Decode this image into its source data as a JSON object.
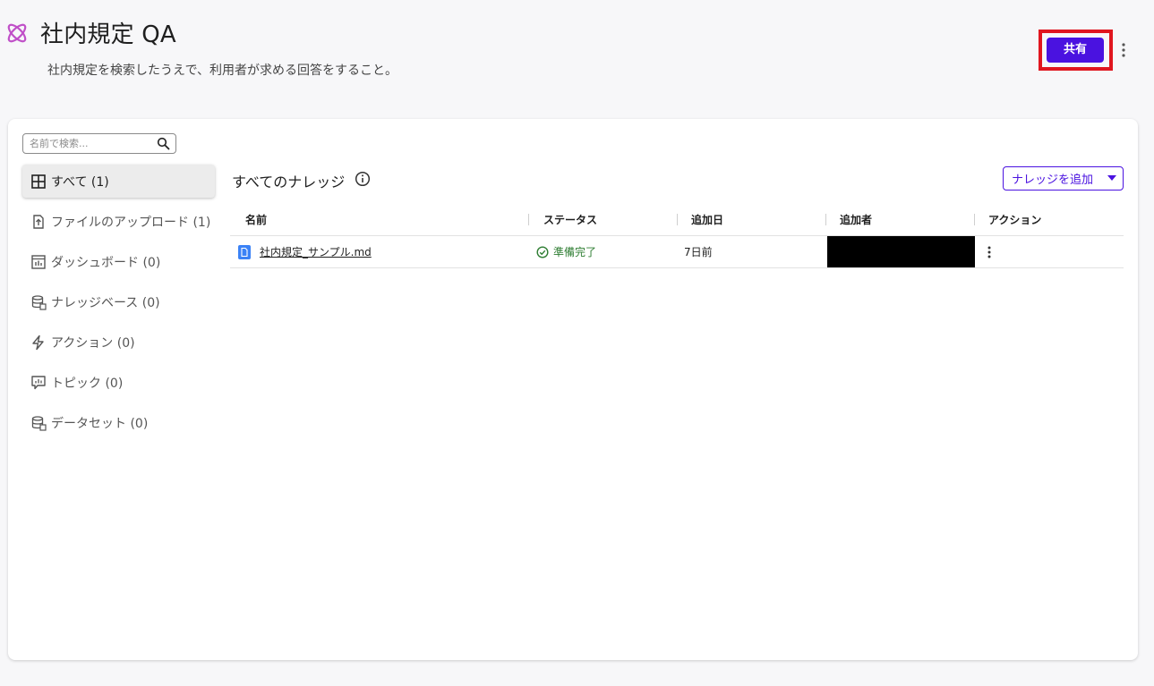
{
  "header": {
    "title": "社内規定 QA",
    "subtitle": "社内規定を検索したうえで、利用者が求める回答をすること。",
    "share_label": "共有"
  },
  "search": {
    "placeholder": "名前で検索..."
  },
  "sidebar": {
    "items": [
      {
        "label": "すべて (1)",
        "icon": "grid-icon"
      },
      {
        "label": "ファイルのアップロード (1)",
        "icon": "file-upload-icon"
      },
      {
        "label": "ダッシュボード (0)",
        "icon": "dashboard-icon"
      },
      {
        "label": "ナレッジベース (0)",
        "icon": "database-icon"
      },
      {
        "label": "アクション (0)",
        "icon": "lightning-icon"
      },
      {
        "label": "トピック (0)",
        "icon": "topic-icon"
      },
      {
        "label": "データセット (0)",
        "icon": "dataset-icon"
      }
    ]
  },
  "main": {
    "section_title": "すべてのナレッジ",
    "add_button_label": "ナレッジを追加",
    "table": {
      "columns": [
        "名前",
        "ステータス",
        "追加日",
        "追加者",
        "アクション"
      ],
      "rows": [
        {
          "name": "社内規定_サンプル.md",
          "status": "準備完了",
          "added": "7日前",
          "added_by": ""
        }
      ]
    }
  },
  "colors": {
    "accent": "#4a12e0",
    "highlight_border": "#e0161f",
    "status_ready": "#2e7d32",
    "logo": "#c050c8",
    "file_icon": "#3b82f6"
  }
}
